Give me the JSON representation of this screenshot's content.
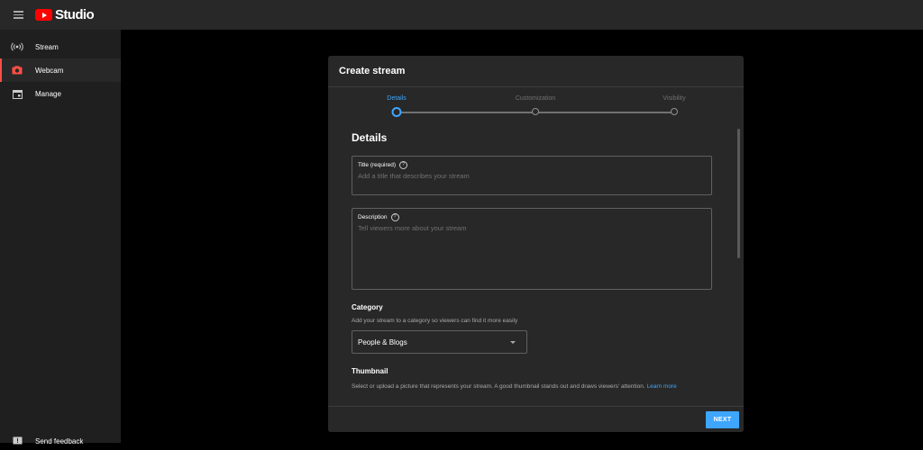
{
  "app": {
    "logo_text": "Studio"
  },
  "sidebar": {
    "items": [
      {
        "label": "Stream",
        "icon": "broadcast-icon",
        "active": false
      },
      {
        "label": "Webcam",
        "icon": "camera-icon",
        "active": true
      },
      {
        "label": "Manage",
        "icon": "calendar-icon",
        "active": false
      }
    ],
    "feedback_label": "Send feedback"
  },
  "dialog": {
    "title": "Create stream",
    "steps": [
      "Details",
      "Customization",
      "Visibility"
    ],
    "active_step": "Details",
    "section_title": "Details",
    "title_field": {
      "label": "Title (required)",
      "placeholder": "Add a title that describes your stream",
      "value": ""
    },
    "description_field": {
      "label": "Description",
      "placeholder": "Tell viewers more about your stream",
      "value": ""
    },
    "category": {
      "title": "Category",
      "help": "Add your stream to a category so viewers can find it more easily",
      "selected": "People & Blogs"
    },
    "thumbnail": {
      "title": "Thumbnail",
      "help": "Select or upload a picture that represents your stream. A good thumbnail stands out and draws viewers' attention.",
      "link": "Learn more"
    },
    "next_label": "NEXT"
  },
  "colors": {
    "accent": "#3ea6ff",
    "brand": "#ff0000",
    "active_indicator": "#ff4e45"
  }
}
